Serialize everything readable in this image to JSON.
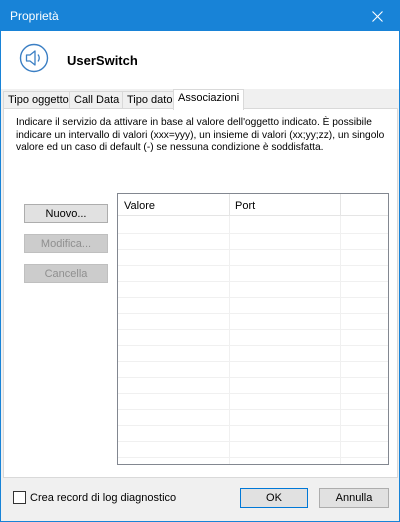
{
  "window": {
    "title": "Proprietà"
  },
  "header": {
    "app_name": "UserSwitch",
    "icon": "speaker-icon"
  },
  "tabs": [
    {
      "label": "Tipo oggetto",
      "active": false
    },
    {
      "label": "Call Data",
      "active": false
    },
    {
      "label": "Tipo dato",
      "active": false
    },
    {
      "label": "Associazioni",
      "active": true
    }
  ],
  "panel": {
    "description": "Indicare il servizio da attivare in base al valore dell'oggetto indicato. È possibile indicare un intervallo di valori (xxx=yyy), un insieme di valori (xx;yy;zz), un singolo valore ed un caso di default (-) se nessuna condizione è soddisfatta.",
    "buttons": {
      "new": "Nuovo...",
      "edit": "Modifica...",
      "delete": "Cancella"
    },
    "table": {
      "columns": [
        "Valore",
        "Port"
      ],
      "rows": []
    }
  },
  "footer": {
    "checkbox_label": "Crea record di log diagnostico",
    "checkbox_checked": false,
    "ok": "OK",
    "cancel": "Annulla"
  },
  "colors": {
    "titlebar": "#1883d7",
    "accent": "#0078d7"
  }
}
